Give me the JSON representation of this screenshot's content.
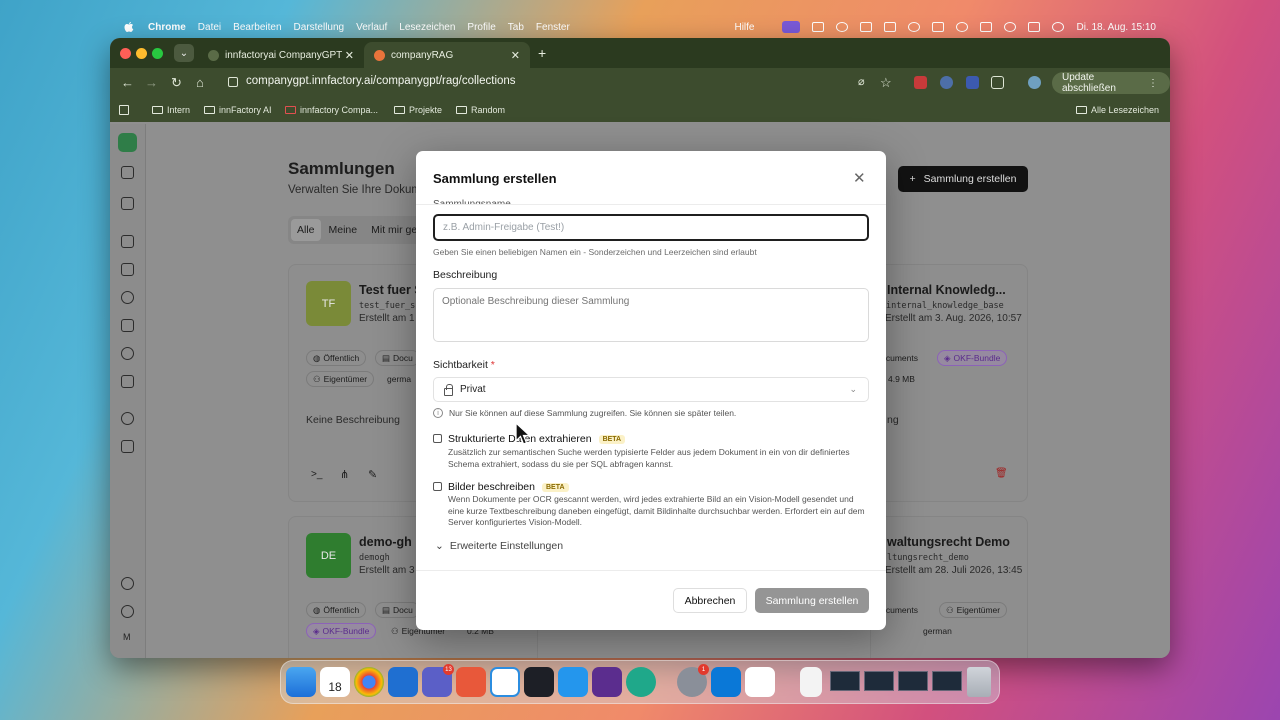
{
  "menubar": {
    "app": "Chrome",
    "items": [
      "Datei",
      "Bearbeiten",
      "Darstellung",
      "Verlauf",
      "Lesezeichen",
      "Profile",
      "Tab",
      "Fenster"
    ],
    "help": "Hilfe",
    "datetime": "Di. 18. Aug.  15:10"
  },
  "browser": {
    "tabs": [
      {
        "title": "innfactoryai CompanyGPT",
        "active": false
      },
      {
        "title": "companyRAG",
        "active": true
      }
    ],
    "url": "companygpt.innfactory.ai/companygpt/rag/collections",
    "update_label": "Update abschließen",
    "bookmarks": [
      "Intern",
      "innFactory AI",
      "innfactory Compa...",
      "Projekte",
      "Random"
    ],
    "all_bookmarks": "Alle Lesezeichen"
  },
  "page": {
    "title": "Sammlungen",
    "subtitle": "Verwalten Sie Ihre Dokum",
    "filters": [
      "Alle",
      "Meine",
      "Mit mir get"
    ],
    "create_button": "Sammlung erstellen",
    "sidebar_initial": "M",
    "cards": [
      {
        "initials": "TF",
        "title": "Test fuer S",
        "code": "test_fuer_s",
        "date": "Erstellt am 1",
        "visibility": "Öffentlich",
        "docs": "Docu",
        "owner": "Eigentümer",
        "lang": "germa",
        "desc": "Keine Beschreibung"
      },
      {
        "title": "Internal Knowledg...",
        "code": "internal_knowledge_base",
        "date": "Erstellt am 3. Aug. 2026, 10:57",
        "docs": "Documents",
        "bundle": "OKF-Bundle",
        "size": "4.9 MB",
        "desc": "ng"
      },
      {
        "initials": "DE",
        "title": "demo-gh",
        "code": "demogh",
        "date": "Erstellt am 3",
        "visibility": "Öffentlich",
        "docs": "Docu",
        "bundle": "OKF-Bundle",
        "owner": "Eigentümer",
        "size": "0.2 MB"
      },
      {
        "title": "waltungsrecht Demo",
        "code": "ltungsrecht_demo",
        "date": "Erstellt am 28. Juli 2026, 13:45",
        "docs": "Documents",
        "owner": "Eigentümer",
        "lang": "german"
      }
    ],
    "middle_lang": "german"
  },
  "modal": {
    "title": "Sammlung erstellen",
    "name_label_cut": "Sammlungsname",
    "name_placeholder": "z.B. Admin-Freigabe (Test!)",
    "name_help": "Geben Sie einen beliebigen Namen ein - Sonderzeichen und Leerzeichen sind erlaubt",
    "description_label": "Beschreibung",
    "description_placeholder": "Optionale Beschreibung dieser Sammlung",
    "visibility_label": "Sichtbarkeit",
    "visibility_value": "Privat",
    "visibility_info": "Nur Sie können auf diese Sammlung zugreifen. Sie können sie später teilen.",
    "structured_title": "Strukturierte Daten extrahieren",
    "structured_desc": "Zusätzlich zur semantischen Suche werden typisierte Felder aus jedem Dokument in ein von dir definiertes Schema extrahiert, sodass du sie per SQL abfragen kannst.",
    "images_title": "Bilder beschreiben",
    "images_desc": "Wenn Dokumente per OCR gescannt werden, wird jedes extrahierte Bild an ein Vision-Modell gesendet und eine kurze Textbeschreibung daneben eingefügt, damit Bildinhalte durchsuchbar werden. Erfordert ein auf dem Server konfiguriertes Vision-Modell.",
    "beta": "BETA",
    "advanced": "Erweiterte Einstellungen",
    "cancel": "Abbrechen",
    "submit": "Sammlung erstellen"
  },
  "dock": {
    "calendar_day": "18",
    "badges": [
      "13",
      "1"
    ]
  },
  "colors": {
    "accent_green": "#2f7d48",
    "beta_bg": "#fbf1c7",
    "bundle_purple": "#8c62b8",
    "required": "#dd3333"
  }
}
